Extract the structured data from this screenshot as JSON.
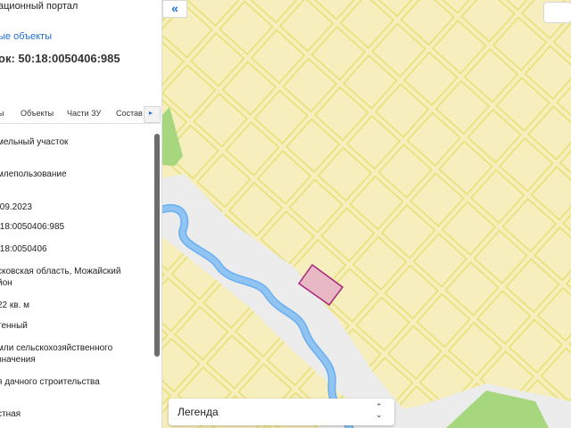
{
  "panel": {
    "portal_title": "ационный портал",
    "link_text": "ые объекты",
    "parcel_title": "ок: 50:18:0050406:985",
    "tabs": [
      {
        "label": "ы"
      },
      {
        "label": "Объекты"
      },
      {
        "label": "Части ЗУ"
      },
      {
        "label": "Состав"
      }
    ],
    "next_tab_icon": "▸",
    "fields": [
      "мельный участок",
      "млепользование",
      ".09.2023",
      ":18:0050406:985",
      ":18:0050406",
      "сковская область, Можайский",
      "йон",
      "22 кв. м",
      "тенный",
      "мли сельскохозяйственного",
      "значения",
      "я дачного строительства",
      "стная"
    ]
  },
  "map": {
    "collapse_icon": "«",
    "legend_label": "Легенда",
    "legend_arrow_up": "⌃",
    "legend_arrow_down": "⌄",
    "colors": {
      "background": "#f6eebc",
      "parcel_border": "#e6df72",
      "river": "#8fc4f3",
      "river_outline": "#6aaef0",
      "road": "#ececec",
      "forest": "#a6d77f",
      "selected_fill": "#e8b9c4",
      "selected_border": "#a8227a"
    }
  }
}
